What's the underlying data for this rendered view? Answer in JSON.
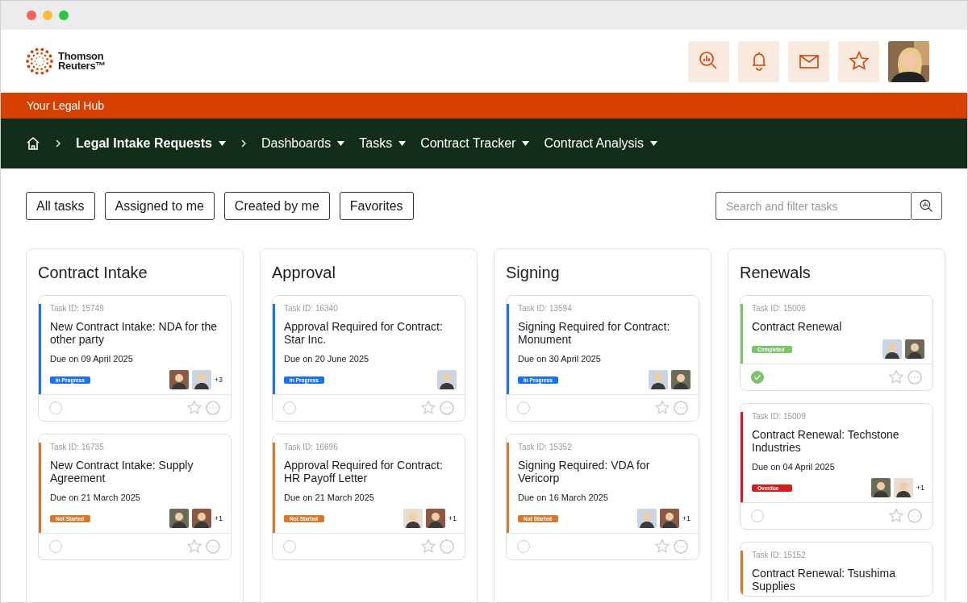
{
  "logo": {
    "lines": [
      "Thomson",
      "Reuters™"
    ]
  },
  "header_buttons": [
    {
      "kind": "analytics-search"
    },
    {
      "kind": "bell"
    },
    {
      "kind": "mail"
    },
    {
      "kind": "star"
    }
  ],
  "hub_bar": {
    "title": "Your Legal Hub"
  },
  "nav": [
    {
      "label": "Legal Intake Requests",
      "selected": true,
      "chevron_before": true
    },
    {
      "label": "Dashboards",
      "selected": false,
      "chevron_before": true
    },
    {
      "label": "Tasks",
      "selected": false,
      "chevron_before": false
    },
    {
      "label": "Contract Tracker",
      "selected": false,
      "chevron_before": false
    },
    {
      "label": "Contract Analysis",
      "selected": false,
      "chevron_before": false
    }
  ],
  "filters": [
    "All tasks",
    "Assigned to me",
    "Created by me",
    "Favorites"
  ],
  "search": {
    "placeholder": "Search and filter tasks"
  },
  "columns": [
    {
      "title": "Contract Intake",
      "cards": [
        {
          "id": "Task ID: 15749",
          "title": "New Contract Intake: NDA for the other party",
          "due": "Due on 09 April 2025",
          "status": {
            "kind": "in_progress",
            "label": "In Progress"
          },
          "avatars": [
            {
              "color": "#8a5a44"
            },
            {
              "color": "#c9d6e2"
            }
          ],
          "more": "+3",
          "done": false
        },
        {
          "id": "Task ID: 16735",
          "title": "New Contract Intake: Supply Agreement",
          "due": "Due on 21 March 2025",
          "status": {
            "kind": "not_started",
            "label": "Not Started"
          },
          "avatars": [
            {
              "color": "#6b6b5a"
            },
            {
              "color": "#8a5a44"
            }
          ],
          "more": "+1",
          "done": false
        }
      ]
    },
    {
      "title": "Approval",
      "cards": [
        {
          "id": "Task ID: 16340",
          "title": "Approval Required for Contract: Star Inc.",
          "due": "Due on 20 June 2025",
          "status": {
            "kind": "in_progress",
            "label": "In Progress"
          },
          "avatars": [
            {
              "color": "#c9d6e2"
            }
          ],
          "done": false
        },
        {
          "id": "Task ID: 16696",
          "title": "Approval Required for Contract: HR Payoff Letter",
          "due": "Due on 21 March 2025",
          "status": {
            "kind": "not_started",
            "label": "Not Started"
          },
          "avatars": [
            {
              "color": "#e8dccf"
            },
            {
              "color": "#8a5a44"
            }
          ],
          "more": "+1",
          "done": false
        }
      ]
    },
    {
      "title": "Signing",
      "cards": [
        {
          "id": "Task ID: 13594",
          "title": "Signing Required for Contract: Monument",
          "due": "Due on 30 April 2025",
          "status": {
            "kind": "in_progress",
            "label": "In Progress"
          },
          "avatars": [
            {
              "color": "#c9d6e2"
            },
            {
              "color": "#6b6b5a"
            }
          ],
          "done": false
        },
        {
          "id": "Task ID: 15352",
          "title": "Signing Required: VDA for Vericorp",
          "due": "Due on 16 March 2025",
          "status": {
            "kind": "not_started",
            "label": "Not Started"
          },
          "avatars": [
            {
              "color": "#c9d6e2"
            },
            {
              "color": "#8a5a44"
            }
          ],
          "more": "+1",
          "done": false
        }
      ]
    },
    {
      "title": "Renewals",
      "cards": [
        {
          "id": "Task ID: 15006",
          "title": "Contract Renewal",
          "status": {
            "kind": "completed",
            "label": "Completed"
          },
          "avatars": [
            {
              "color": "#c9d6e2"
            },
            {
              "color": "#6b6b5a"
            }
          ],
          "done": true
        },
        {
          "id": "Task ID: 15009",
          "title": "Contract Renewal: Techstone Industries",
          "due": "Due on 04 April 2025",
          "status": {
            "kind": "overdue",
            "label": "Overdue"
          },
          "avatars": [
            {
              "color": "#6b6b5a"
            },
            {
              "color": "#e8dccf"
            }
          ],
          "more": "+1",
          "done": false
        },
        {
          "id": "Task ID: 15152",
          "title": "Contract Renewal: Tsushima Supplies",
          "status": {
            "kind": "not_started"
          }
        }
      ]
    }
  ]
}
